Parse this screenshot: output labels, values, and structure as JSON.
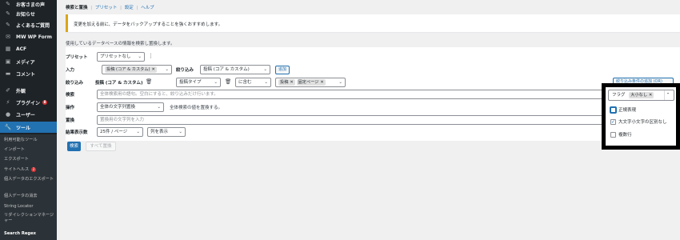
{
  "sidebar": {
    "items": [
      {
        "label": "お客さまの声",
        "icon": "pin-icon"
      },
      {
        "label": "お知らせ",
        "icon": "pin-icon"
      },
      {
        "label": "よくあるご質問",
        "icon": "pin-icon"
      },
      {
        "label": "MW WP Form",
        "icon": "mail-icon"
      },
      {
        "label": "ACF",
        "icon": "grid-icon"
      },
      {
        "label": "メディア",
        "icon": "media-icon"
      },
      {
        "label": "コメント",
        "icon": "comment-icon"
      },
      {
        "label": "外観",
        "icon": "brush-icon"
      },
      {
        "label": "プラグイン",
        "icon": "plugin-icon",
        "badge": "8"
      },
      {
        "label": "ユーザー",
        "icon": "user-icon"
      },
      {
        "label": "ツール",
        "icon": "wrench-icon"
      }
    ],
    "submenu": [
      {
        "label": "利用可能なツール"
      },
      {
        "label": "インポート"
      },
      {
        "label": "エクスポート"
      },
      {
        "label": "サイトヘルス",
        "badge": "2"
      },
      {
        "label": "個人データのエクスポート"
      },
      {
        "label": "個人データの消去"
      },
      {
        "label": "String Locator"
      },
      {
        "label": "リダイレクションマネージャー"
      },
      {
        "label": "Search Regex"
      }
    ]
  },
  "tabs": {
    "active": "検索と置換",
    "sep": "|",
    "items": [
      "プリセット",
      "設定",
      "ヘルプ"
    ]
  },
  "notice": "変更を加える前に、データをバックアップすることを強くおすすめします。",
  "description": "使用しているデータベースの情報を検索し置換します。",
  "form": {
    "preset_label": "プリセット",
    "preset_value": "プリセットなし",
    "input_label": "入力",
    "input_chip": "投稿 (コア & カスタム)",
    "filter_label": "絞り込み",
    "filter_value": "投稿 (コア & カスタム)",
    "add_button": "追加",
    "filter_row_label": "絞り込み",
    "filter_row_title": "投稿 (コア & カスタム)",
    "post_type": "投稿タイプ",
    "contains": "に含む",
    "chip_post": "投稿",
    "chip_fixed": "固定ページ",
    "add_condition_button": "絞り込み条件の追加 (OR)",
    "search_label": "検索",
    "search_placeholder": "全体検索用の語句。空白にすると、絞り込みだけ行います。",
    "operation_label": "操作",
    "operation_value": "全体の文字列置換",
    "operation_help": "全体検索の値を置換する。",
    "replace_label": "置換",
    "replace_placeholder": "置換用の文字列を入力",
    "results_label": "結果表示数",
    "per_page": "25件 / ページ",
    "columns": "列を表示",
    "search_button": "検索",
    "replace_all_button": "すべて置換"
  },
  "flags": {
    "label": "フラグ",
    "chip": "大小なし",
    "options": [
      {
        "label": "正規表現",
        "checked": false
      },
      {
        "label": "大文字小文字の区別なし",
        "checked": true
      },
      {
        "label": "複数行",
        "checked": false
      }
    ]
  },
  "colors": {
    "sidebar_bg": "#1d2327",
    "accent": "#2271b1",
    "notice": "#dba617",
    "badge": "#d63638"
  }
}
